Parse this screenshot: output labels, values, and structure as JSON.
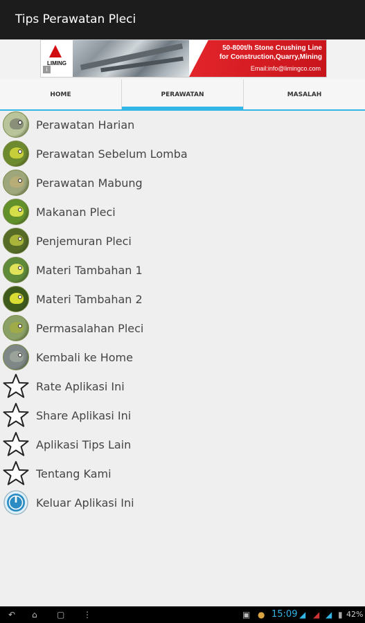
{
  "app": {
    "title": "Tips Perawatan Pleci"
  },
  "ad": {
    "brand": "LIMING",
    "headline1": "50-800t/h Stone Crushing Line",
    "headline2": "for Construction,Quarry,Mining",
    "email": "Email:info@limingco.com",
    "info_icon": "info-icon"
  },
  "tabs": [
    {
      "label": "HOME"
    },
    {
      "label": "PERAWATAN",
      "active": true
    },
    {
      "label": "MASALAH"
    }
  ],
  "menu": [
    {
      "label": "Perawatan Harian",
      "icon": "bird-icon",
      "bg": "#b9c49a",
      "bird": "#8a8f7a"
    },
    {
      "label": "Perawatan Sebelum Lomba",
      "icon": "bird-icon",
      "bg": "#6e8a2e",
      "bird": "#c6cf3a"
    },
    {
      "label": "Perawatan Mabung",
      "icon": "bird-icon",
      "bg": "#9ea77b",
      "bird": "#b8ad76"
    },
    {
      "label": "Makanan Pleci",
      "icon": "bird-icon",
      "bg": "#62902b",
      "bird": "#d6de4a"
    },
    {
      "label": "Penjemuran Pleci",
      "icon": "bird-icon",
      "bg": "#556b26",
      "bird": "#a9b43b"
    },
    {
      "label": "Materi Tambahan 1",
      "icon": "bird-icon",
      "bg": "#5f8a3a",
      "bird": "#e0e35a"
    },
    {
      "label": "Materi Tambahan 2",
      "icon": "bird-icon",
      "bg": "#3f5b1c",
      "bird": "#d9dd33"
    },
    {
      "label": "Permasalahan Pleci",
      "icon": "bird-icon",
      "bg": "#8aa066",
      "bird": "#9faa48"
    },
    {
      "label": "Kembali ke Home",
      "icon": "bird-icon",
      "bg": "#7f8886",
      "bird": "#9aa29a"
    },
    {
      "label": "Rate Aplikasi Ini",
      "icon": "star-icon"
    },
    {
      "label": "Share Aplikasi Ini",
      "icon": "star-icon"
    },
    {
      "label": "Aplikasi Tips Lain",
      "icon": "star-icon"
    },
    {
      "label": "Tentang Kami",
      "icon": "star-icon"
    },
    {
      "label": "Keluar Aplikasi Ini",
      "icon": "power-icon"
    }
  ],
  "status": {
    "time": "15:09",
    "battery": "42%"
  }
}
